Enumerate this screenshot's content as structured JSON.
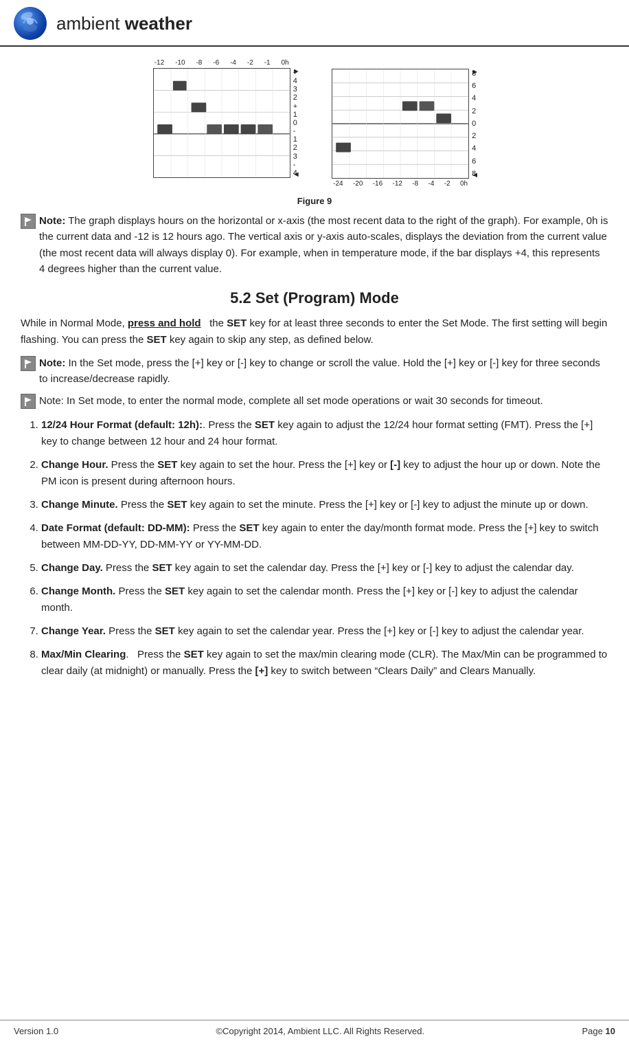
{
  "header": {
    "logo_alt": "Ambient Weather Logo",
    "brand_name_regular": "ambient ",
    "brand_name_bold": "weather"
  },
  "figure": {
    "label": "Figure 9",
    "left_graph": {
      "x_labels": [
        "-12",
        "-10",
        "-8",
        "-6",
        "-4",
        "-2",
        "-1",
        "0h"
      ],
      "y_right_labels": [
        "+",
        "4",
        "3",
        "2",
        "+",
        "1",
        "0",
        "-",
        "1",
        "2",
        "3",
        "-",
        "4"
      ],
      "arrow_top": "►",
      "arrow_bottom": "◄"
    },
    "right_graph": {
      "x_labels": [
        "-24",
        "-20",
        "-16",
        "-12",
        "-8",
        "-4",
        "-2",
        "0h"
      ],
      "y_right_labels": [
        "8",
        "6",
        "4",
        "2",
        "0",
        "2",
        "4",
        "6",
        "8"
      ],
      "arrow_top": "►",
      "arrow_bottom": "◄"
    }
  },
  "note1": {
    "label": "Note:",
    "text": "The graph displays hours on the horizontal or x-axis (the most recent data to the right of the graph). For example, 0h is the current data and -12 is 12 hours ago. The vertical axis or y-axis auto-scales, displays the deviation from the current value (the most recent data will always display 0). For example, when in temperature mode, if the bar displays +4, this represents 4 degrees higher than the current value."
  },
  "section": {
    "heading": "5.2 Set (Program) Mode"
  },
  "para1": {
    "text_before": "While in Normal Mode, ",
    "underline_bold": "press and hold",
    "text_after": "   the ",
    "bold1": "SET",
    "text_after2": " key for at least three seconds to enter the Set Mode. The first setting will begin flashing. You can press the ",
    "bold2": "SET",
    "text_after3": " key again to skip any step, as defined below."
  },
  "note2": {
    "label": "Note:",
    "text1": "In the Set mode, press the [+] key or [-] key to change or scroll the value. Hold the [+] key or [-] key for three seconds to increase/decrease rapidly."
  },
  "note3": {
    "text": "Note: In Set mode, to enter the normal mode, complete all set mode operations or wait 30 seconds for timeout."
  },
  "list": {
    "items": [
      {
        "bold_label": "12/24 Hour Format (default: 12h):",
        "text": ". Press the ",
        "bold_set": "SET",
        "text2": " key again to adjust the 12/24 hour format setting (FMT). Press the [+] key to change between 12 hour and 24 hour format."
      },
      {
        "bold_label": "Change Hour.",
        "text": " Press the ",
        "bold_set": "SET",
        "text2": " key again to set the hour. Press the [+] key or ",
        "bold_minus": "[-]",
        "text3": " key to adjust the hour up or down. Note the PM icon is present during afternoon hours."
      },
      {
        "bold_label": "Change Minute.",
        "text": " Press the ",
        "bold_set": "SET",
        "text2": " key again to set the minute. Press the [+] key or [-] key to adjust the minute up or down."
      },
      {
        "bold_label": "Date Format (default: DD-MM):",
        "text": " Press the ",
        "bold_set": "SET",
        "text2": " key again to enter the day/month format mode. Press the [+] key to switch between MM-DD-YY, DD-MM-YY or YY-MM-DD."
      },
      {
        "bold_label": "Change Day.",
        "text": " Press the ",
        "bold_set": "SET",
        "text2": " key again to set the calendar day. Press the [+] key or [-] key to adjust the calendar day."
      },
      {
        "bold_label": "Change Month.",
        "text": " Press the ",
        "bold_set": "SET",
        "text2": " key again to set the calendar month. Press the [+] key or [-] key to adjust the calendar month."
      },
      {
        "bold_label": "Change Year.",
        "text": " Press the ",
        "bold_set": "SET",
        "text2": " key again to set the calendar year. Press the [+] key or [-] key to adjust the calendar year."
      },
      {
        "bold_label": "Max/Min Clearing",
        "text": ".    Press the ",
        "bold_set": "SET",
        "text2": " key again to set the max/min clearing mode (CLR). The Max/Min can be programmed to clear daily (at midnight) or manually. Press the ",
        "bold_plus": "[+]",
        "text3": " key to switch between “Clears Daily” and Clears Manually."
      }
    ]
  },
  "footer": {
    "version": "Version 1.0",
    "copyright": "©Copyright 2014, Ambient LLC. All Rights Reserved.",
    "page_label": "Page",
    "page_number": "10"
  }
}
